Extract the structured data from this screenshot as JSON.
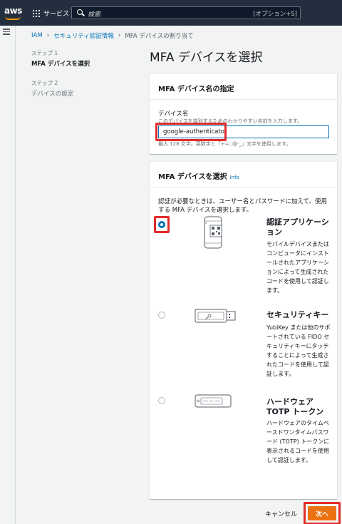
{
  "nav": {
    "logo": "aws",
    "services_label": "サービス",
    "search_placeholder": "検索",
    "search_shortcut": "[オプション+S]"
  },
  "breadcrumb": {
    "items": [
      "IAM",
      "セキュリティ認証情報",
      "MFA デバイスの割り当て"
    ]
  },
  "steps": [
    {
      "number": "ステップ 1",
      "title": "MFA デバイスを選択"
    },
    {
      "number": "ステップ 2",
      "title": "デバイスの設定"
    }
  ],
  "page_title": "MFA デバイスを選択",
  "name_card": {
    "heading": "MFA デバイス名の指定",
    "label": "デバイス名",
    "description": "このデバイスを識別するためのわかりやすい名前を入力します。",
    "value": "google-authenticator",
    "hint": "最大 128 文字。英数字と「+=,.@-_」文字を使用します。"
  },
  "device_card": {
    "heading": "MFA デバイスを選択",
    "info_label": "Info",
    "intro": "認証が必要なときは、ユーザー名とパスワードに加えて、使用する MFA デバイスを選択します。",
    "options": [
      {
        "title": "認証アプリケーション",
        "description": "モバイルデバイスまたはコンピュータにインストールされたアプリケーションによって生成されたコードを使用して認証します。",
        "selected": true,
        "icon": "phone-qr-icon"
      },
      {
        "title": "セキュリティキー",
        "description": "YubiKey または他のサポートされている FIDO セキュリティキーにタッチすることによって生成されたコードを使用して認証します。",
        "selected": false,
        "icon": "usb-key-icon"
      },
      {
        "title": "ハードウェア TOTP トークン",
        "description": "ハードウェアのタイムベースドワンタイムパスワード (TOTP) トークンに表示されるコードを使用して認証します。",
        "selected": false,
        "icon": "hardware-token-icon"
      }
    ]
  },
  "footer": {
    "cancel_label": "キャンセル",
    "next_label": "次へ"
  },
  "colors": {
    "nav_bg": "#232f3e",
    "accent_blue": "#0073bb",
    "primary_orange": "#ec7211",
    "highlight_red": "#e22b2b"
  }
}
